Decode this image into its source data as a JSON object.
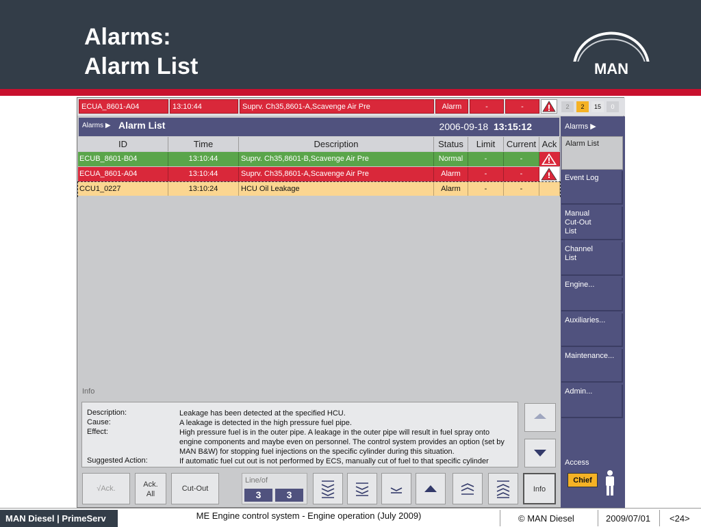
{
  "slide": {
    "title_line1": "Alarms:",
    "title_line2": "Alarm List",
    "logo_text": "MAN"
  },
  "alarm_bar": {
    "id": "ECUA_8601-A04",
    "time": "13:10:44",
    "description": "Suprv. Ch35,8601-A,Scavenge Air Pre",
    "status": "Alarm",
    "limit": "-",
    "current": "-",
    "counts": [
      "2",
      "2",
      "15",
      "0"
    ]
  },
  "list_header": {
    "breadcrumb": "Alarms",
    "title": "Alarm List",
    "date": "2006-09-18",
    "time": "13:15:12"
  },
  "columns": [
    "ID",
    "Time",
    "Description",
    "Status",
    "Limit",
    "Current",
    "Ack"
  ],
  "rows": [
    {
      "id": "ECUB_8601-B04",
      "time": "13:10:44",
      "description": "Suprv. Ch35,8601-B,Scavenge Air Pre",
      "status": "Normal",
      "limit": "-",
      "current": "-"
    },
    {
      "id": "ECUA_8601-A04",
      "time": "13:10:44",
      "description": "Suprv. Ch35,8601-A,Scavenge Air Pre",
      "status": "Alarm",
      "limit": "-",
      "current": "-"
    },
    {
      "id": "CCU1_0227",
      "time": "13:10:24",
      "description": "HCU Oil Leakage",
      "status": "Alarm",
      "limit": "-",
      "current": "-"
    }
  ],
  "info": {
    "label": "Info",
    "description_label": "Description:",
    "description": "Leakage has been detected at the specified HCU.",
    "cause_label": "Cause:",
    "cause": "A leakage is detected in the high pressure fuel pipe.",
    "effect_label": "Effect:",
    "effect": "High pressure fuel is in the outer pipe. A leakage in the outer pipe will result in fuel spray onto engine components and maybe even on personnel. The control system provides an option (set by MAN B&W) for stopping fuel injections on the specific cylinder during this situation.",
    "action_label": "Suggested Action:",
    "action": "If automatic fuel cut out is not performed by ECS, manually cut of fuel to that specific cylinder"
  },
  "bottom_bar": {
    "ack": "√Ack.",
    "ack_all_1": "Ack.",
    "ack_all_2": "All",
    "cut_out": "Cut-Out",
    "lineof_label": "Line/of",
    "line": "3",
    "of": "3",
    "info": "Info"
  },
  "sidebar": {
    "header": "Alarms",
    "alarm_list": "Alarm List",
    "event_log": "Event Log",
    "manual_cutout_1": "Manual",
    "manual_cutout_2": "Cut-Out",
    "manual_cutout_3": "List",
    "channel_list_1": "Channel",
    "channel_list_2": "List",
    "engine": "Engine...",
    "auxiliaries": "Auxiliaries...",
    "maintenance": "Maintenance...",
    "admin": "Admin...",
    "access": "Access",
    "chief": "Chief"
  },
  "footer": {
    "brand": "MAN Diesel | PrimeServ",
    "center": "ME Engine control system - Engine operation (July 2009)",
    "copyright": "© MAN Diesel",
    "date": "2009/07/01",
    "page": "<24>"
  },
  "colors": {
    "header_bg": "#333d48",
    "accent_red": "#c8102e",
    "alarm_red": "#d9283a",
    "normal_green": "#5aa54a",
    "pending_yellow": "#fbd691",
    "panel_navy": "#50527e",
    "chief_orange": "#f5b225"
  }
}
